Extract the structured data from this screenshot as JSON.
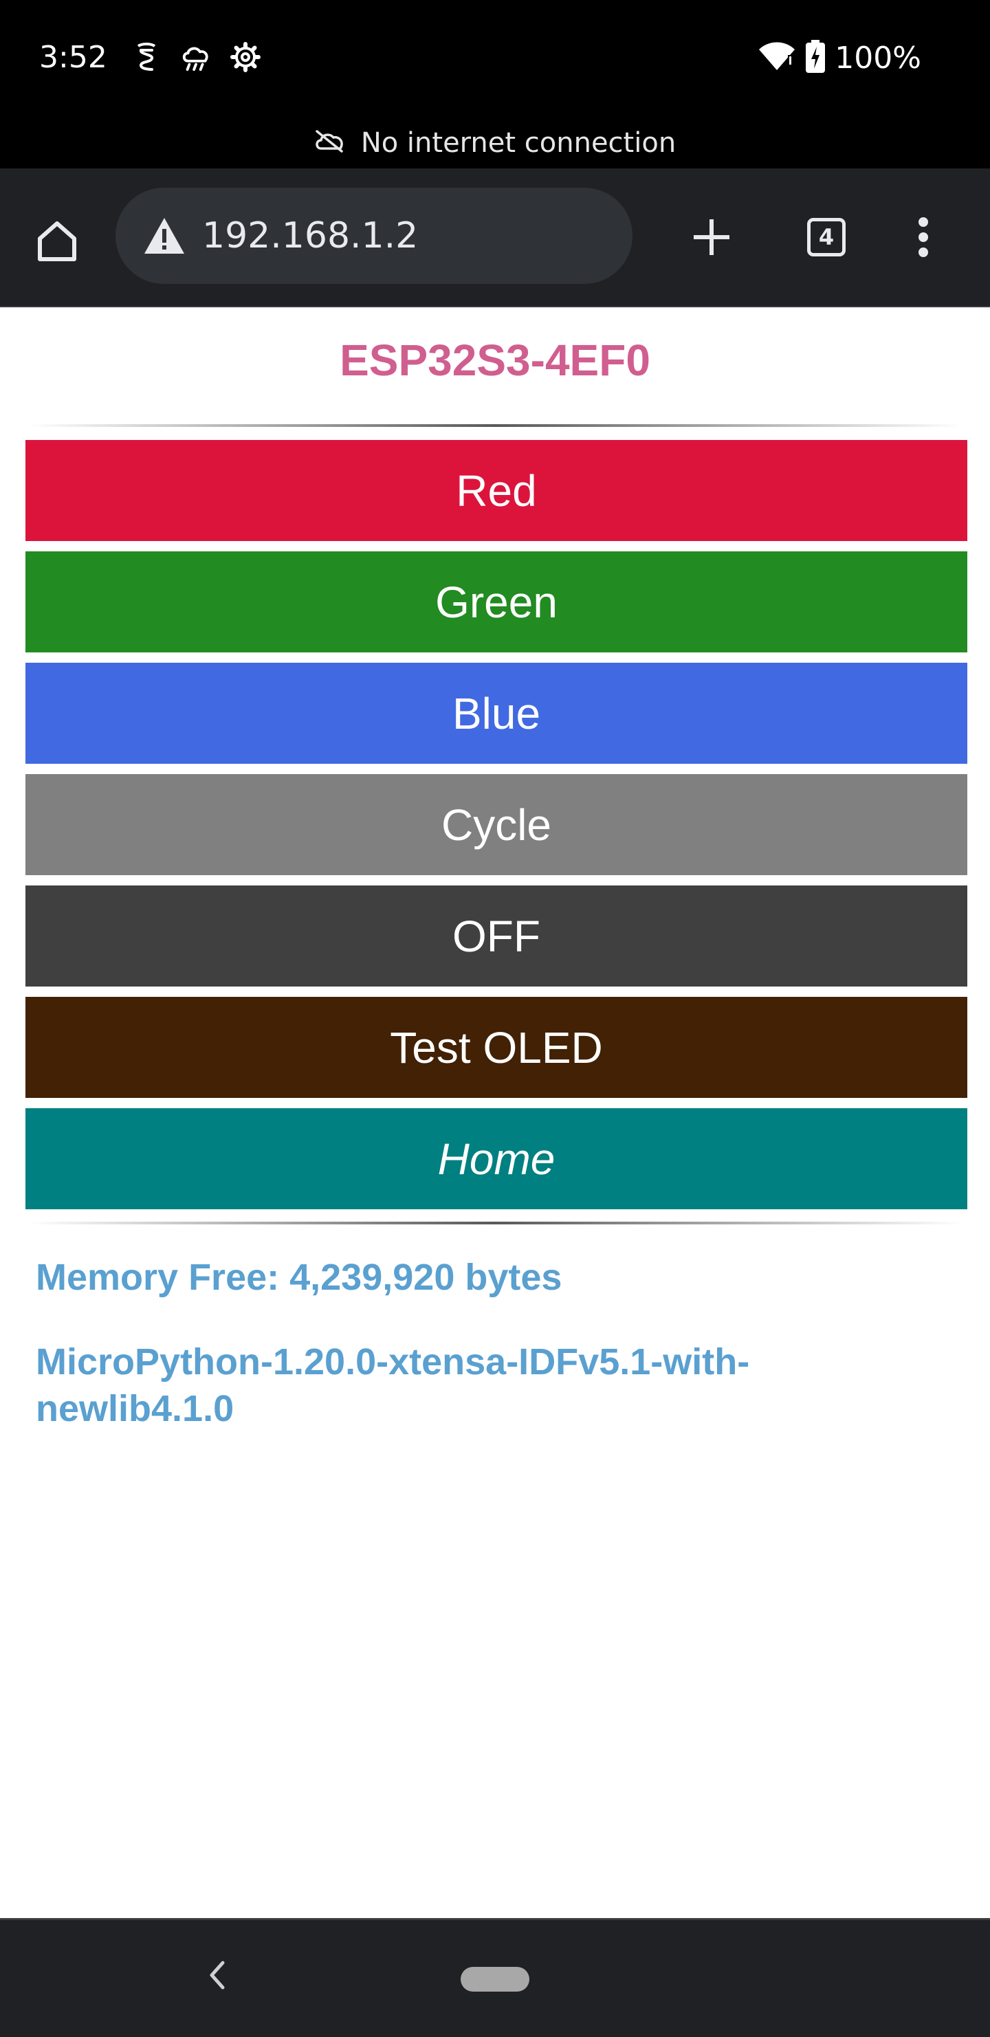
{
  "status_bar": {
    "time": "3:52",
    "left_icons": [
      "rider-icon",
      "cloud-rain-icon",
      "settings-gear-icon"
    ],
    "right_icons": [
      "wifi-icon",
      "battery-charging-icon"
    ],
    "battery_percent": "100%"
  },
  "connectivity_banner": {
    "icon": "cloud-off-icon",
    "text": "No internet connection"
  },
  "browser": {
    "url": "192.168.1.2",
    "tab_count": "4",
    "icons": {
      "home": "home-icon",
      "security": "warning-triangle-icon",
      "new_tab": "plus-icon",
      "menu": "more-vertical-icon"
    }
  },
  "page": {
    "device_name": "ESP32S3-4EF0",
    "buttons": [
      {
        "label": "Red",
        "color": "#DC143C"
      },
      {
        "label": "Green",
        "color": "#228B22"
      },
      {
        "label": "Blue",
        "color": "#4169E1"
      },
      {
        "label": "Cycle",
        "color": "#808080"
      },
      {
        "label": "OFF",
        "color": "#404040"
      },
      {
        "label": "Test OLED",
        "color": "#422104"
      },
      {
        "label": "Home",
        "color": "#008080"
      }
    ],
    "memory_free": "Memory Free: 4,239,920 bytes",
    "firmware_version": "MicroPython-1.20.0-xtensa-IDFv5.1-with-newlib4.1.0"
  },
  "colors": {
    "title": "#D05E8F",
    "info_text": "#5AA0D0",
    "toolbar_bg": "#1F2124"
  }
}
